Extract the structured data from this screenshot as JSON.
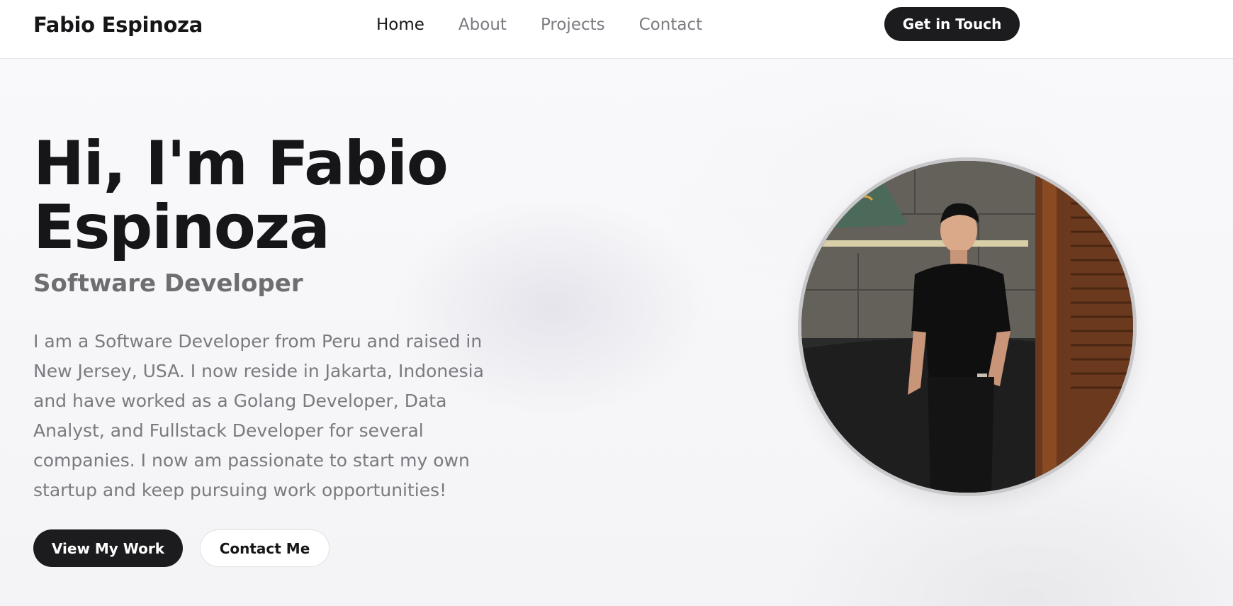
{
  "header": {
    "brand": "Fabio Espinoza",
    "nav": [
      {
        "label": "Home",
        "active": true
      },
      {
        "label": "About",
        "active": false
      },
      {
        "label": "Projects",
        "active": false
      },
      {
        "label": "Contact",
        "active": false
      }
    ],
    "cta_label": "Get in Touch"
  },
  "hero": {
    "title_line1": "Hi, I'm Fabio",
    "title_line2": "Espinoza",
    "subtitle": "Software Developer",
    "description": "I am a Software Developer from Peru and raised in New Jersey, USA. I now reside in Jakarta, Indonesia and have worked as a Golang Developer, Data Analyst, and Fullstack Developer for several companies. I now am passionate to start my own startup and keep pursuing work opportunities!",
    "primary_button": "View My Work",
    "secondary_button": "Contact Me"
  },
  "portrait": {
    "subject": "profile-photo"
  },
  "colors": {
    "text_dark": "#161618",
    "text_muted": "#7a7a80",
    "button_dark": "#1c1c1e",
    "header_bg": "#ffffff"
  }
}
